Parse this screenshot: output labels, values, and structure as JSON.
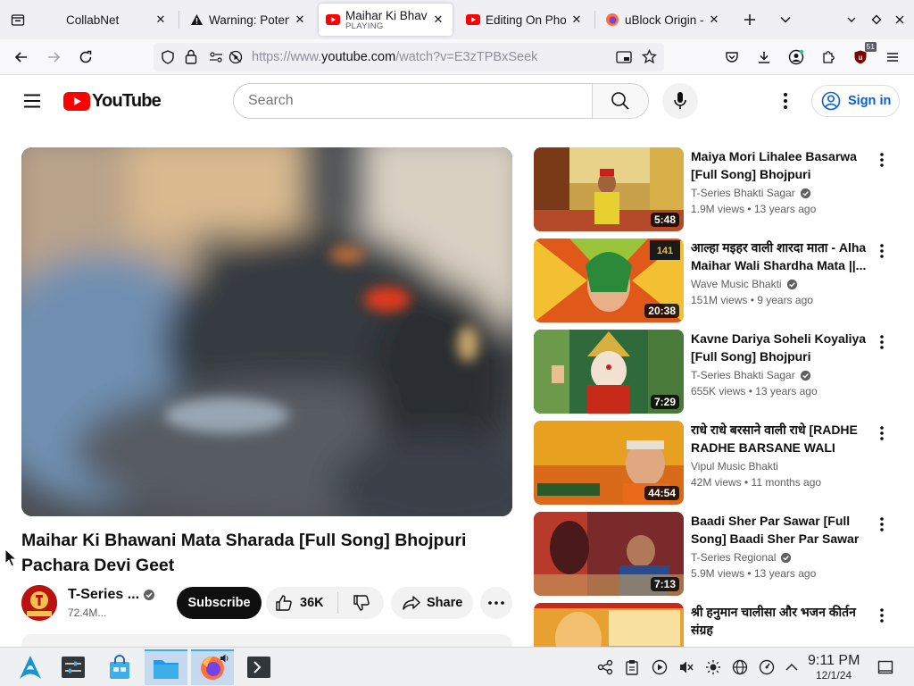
{
  "browser": {
    "tabs": [
      {
        "title": "CollabNet",
        "favicon": "blank-icon"
      },
      {
        "title": "Warning: Poten",
        "favicon": "warning-icon"
      },
      {
        "title": "Maihar Ki Bhav",
        "subtitle": "PLAYING",
        "favicon": "youtube-icon",
        "active": true
      },
      {
        "title": "Editing On Pho",
        "favicon": "youtube-icon"
      },
      {
        "title": "uBlock Origin -",
        "favicon": "firefox-icon"
      }
    ],
    "url": {
      "prefix": "https://www.",
      "host": "youtube.com",
      "path": "/watch?v=E3zTPBxSeek"
    },
    "extension_badge": "51"
  },
  "youtube": {
    "logo_text": "YouTube",
    "search_placeholder": "Search",
    "signin_label": "Sign in",
    "video": {
      "title": "Maihar Ki Bhawani Mata Sharada [Full Song] Bhojpuri Pachara Devi Geet",
      "channel": "T-Series ...",
      "subscribers": "72.4M...",
      "subscribe_label": "Subscribe",
      "likes": "36K",
      "share_label": "Share"
    },
    "recommendations": [
      {
        "title": "Maiya Mori Lihalee Basarwa [Full Song] Bhojpuri Pachara...",
        "channel": "T-Series Bhakti Sagar",
        "verified": true,
        "meta": "1.9M views • 13 years ago",
        "duration": "5:48"
      },
      {
        "title": "आल्हा मइहर वाली शारदा माता - Alha Maihar Wali Shardha Mata ||...",
        "channel": "Wave Music Bhakti",
        "verified": true,
        "meta": "151M views • 9 years ago",
        "duration": "20:38"
      },
      {
        "title": "Kavne Dariya Soheli Koyaliya [Full Song] Bhojpuri Pachara...",
        "channel": "T-Series Bhakti Sagar",
        "verified": true,
        "meta": "655K views • 13 years ago",
        "duration": "7:29"
      },
      {
        "title": "राधे राधे बरसाने वाली राधे [RADHE RADHE BARSANE WALI RADH...",
        "channel": "Vipul Music Bhakti",
        "verified": false,
        "meta": "42M views • 11 months ago",
        "duration": "44:54"
      },
      {
        "title": "Baadi Sher Par Sawar [Full Song] Baadi Sher Par Sawar",
        "channel": "T-Series Regional",
        "verified": true,
        "meta": "5.9M views • 13 years ago",
        "duration": "7:13"
      },
      {
        "title": "श्री हनुमान चालीसा और भजन कीर्तन संग्रह",
        "channel": "",
        "verified": false,
        "meta": "",
        "duration": ""
      }
    ]
  },
  "taskbar": {
    "time": "9:11 PM",
    "date": "12/1/24"
  },
  "colors": {
    "youtube_red": "#ff0000",
    "link_blue": "#065fd4",
    "taskbar_accent": "#3daee9"
  }
}
